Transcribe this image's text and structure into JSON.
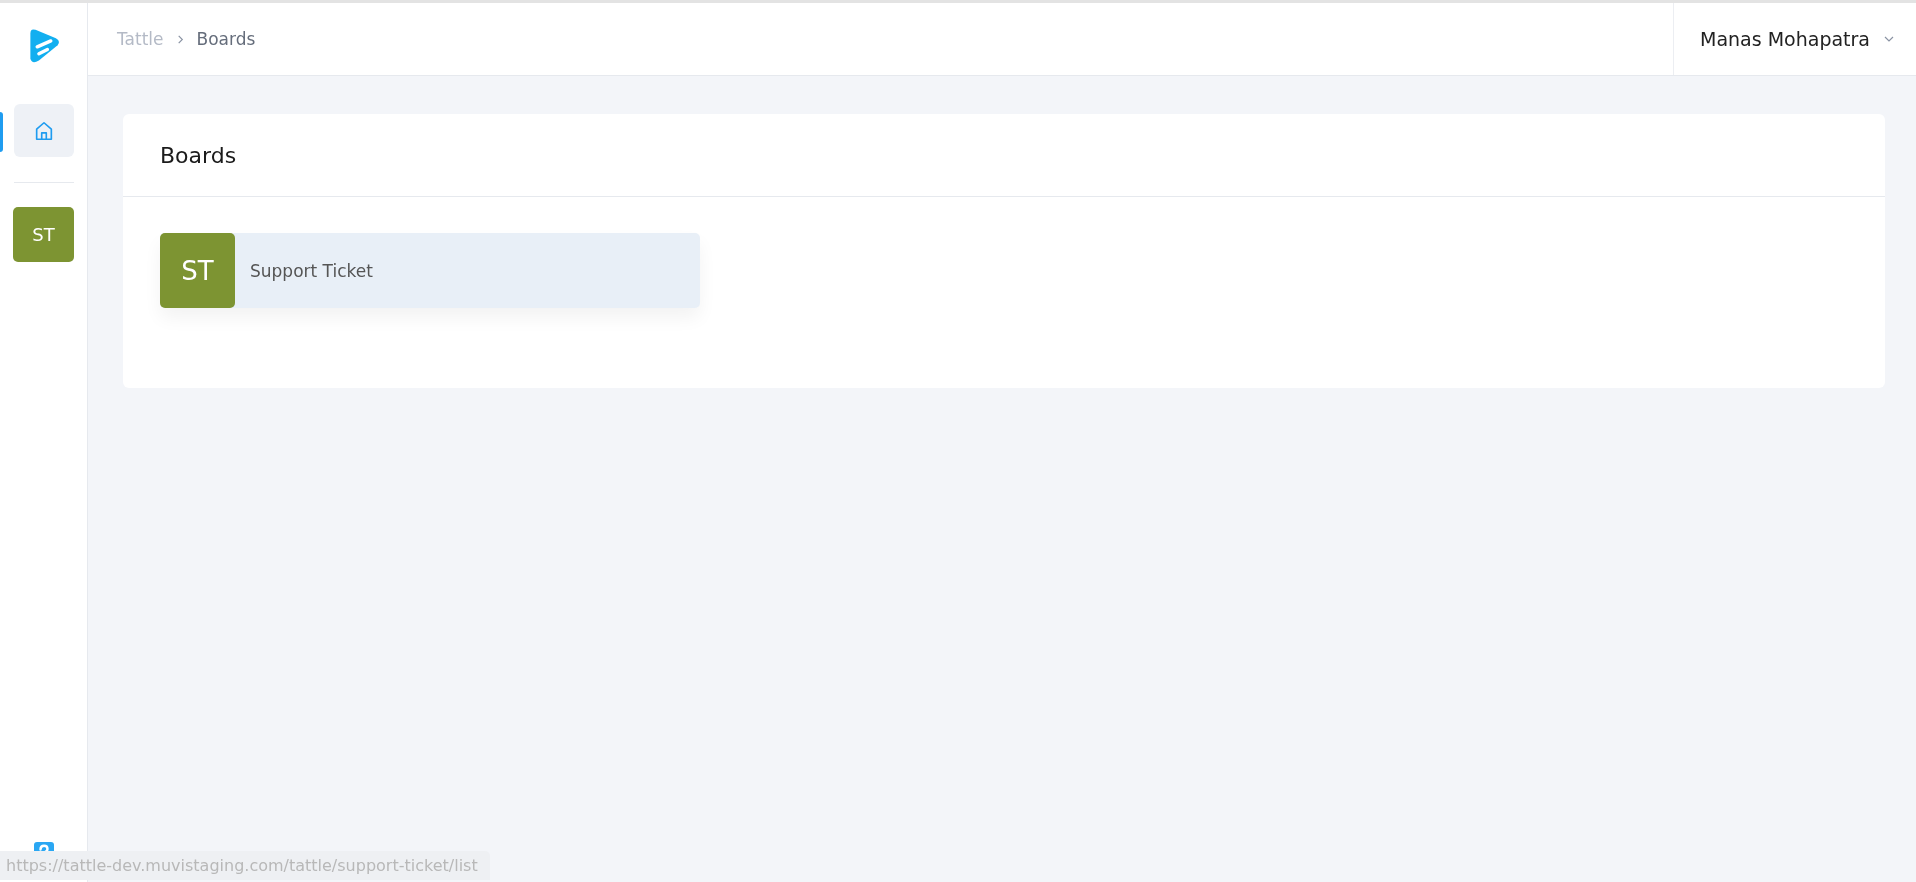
{
  "breadcrumb": [
    {
      "label": "Tattle",
      "current": false
    },
    {
      "label": "Boards",
      "current": true
    }
  ],
  "user": {
    "name": "Manas Mohapatra"
  },
  "sidebar": {
    "items": [
      {
        "kind": "home",
        "selected": true
      },
      {
        "kind": "avatar",
        "initials": "ST",
        "color": "#7d9432",
        "selected": false
      }
    ]
  },
  "panel": {
    "title": "Boards",
    "boards": [
      {
        "initials": "ST",
        "name": "Support Ticket",
        "color": "#7d9432"
      }
    ]
  },
  "status_url": "https://tattle-dev.muvistaging.com/tattle/support-ticket/list"
}
